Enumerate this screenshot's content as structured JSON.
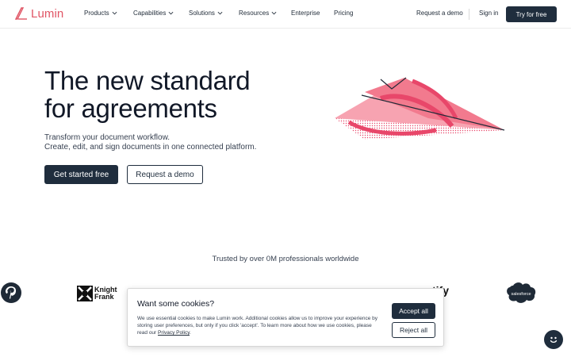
{
  "brand": {
    "name": "Lumin",
    "color": "#e05565"
  },
  "nav": {
    "items": [
      {
        "label": "Products",
        "has_dropdown": true
      },
      {
        "label": "Capabilities",
        "has_dropdown": true
      },
      {
        "label": "Solutions",
        "has_dropdown": true
      },
      {
        "label": "Resources",
        "has_dropdown": true
      },
      {
        "label": "Enterprise",
        "has_dropdown": false
      },
      {
        "label": "Pricing",
        "has_dropdown": false
      }
    ],
    "request_demo": "Request a demo",
    "sign_in": "Sign in",
    "try_free": "Try for free"
  },
  "hero": {
    "title_line1": "The new standard",
    "title_line2": "for agreements",
    "subtitle_line1": "Transform your document workflow.",
    "subtitle_line2": "Create, edit, and sign documents in one connected platform.",
    "primary_cta": "Get started free",
    "secondary_cta": "Request a demo"
  },
  "trusted": {
    "text": "Trusted by over 0M professionals worldwide",
    "logos": [
      "pinterest-logo",
      "knight-frank-logo",
      "salesforce-logo"
    ],
    "knight_frank_line1": "Knight",
    "knight_frank_line2": "Frank",
    "salesforce_label": "salesforce",
    "partial_logo_text": "tify"
  },
  "cookie": {
    "title": "Want some cookies?",
    "body": "We use essential cookies to make Lumin work. Additional cookies allow us to improve your experience by storing user preferences, but only if you click 'accept'. To learn more about how we use cookies, please read our ",
    "link_text": "Privacy Policy",
    "after_link": ".",
    "accept": "Accept all",
    "reject": "Reject all"
  },
  "colors": {
    "dark": "#1f2d3d",
    "accent_pink": "#f27a8e"
  }
}
